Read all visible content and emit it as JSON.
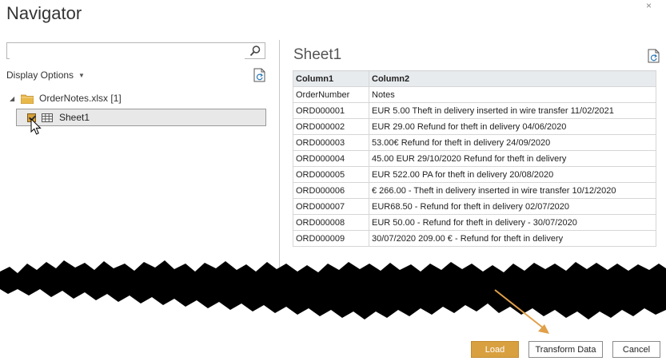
{
  "window": {
    "title": "Navigator",
    "close_glyph": "×"
  },
  "search": {
    "value": "",
    "placeholder": "",
    "icon": "search-icon"
  },
  "display_options": {
    "label": "Display Options",
    "caret": "▼"
  },
  "tree": {
    "file": {
      "label": "OrderNotes.xlsx [1]",
      "expander": "◢",
      "icon": "folder-icon"
    },
    "items": [
      {
        "label": "Sheet1",
        "checked": true,
        "icon": "table-icon"
      }
    ]
  },
  "preview": {
    "title": "Sheet1",
    "columns": [
      "Column1",
      "Column2"
    ],
    "rows": [
      [
        "OrderNumber",
        "Notes"
      ],
      [
        "ORD000001",
        "EUR 5.00 Theft in delivery inserted in wire transfer 11/02/2021"
      ],
      [
        "ORD000002",
        "EUR 29.00 Refund for theft in delivery 04/06/2020"
      ],
      [
        "ORD000003",
        "53.00€ Refund for theft in delivery 24/09/2020"
      ],
      [
        "ORD000004",
        "45.00 EUR 29/10/2020 Refund for theft in delivery"
      ],
      [
        "ORD000005",
        "EUR 522.00 PA for theft in delivery 20/08/2020"
      ],
      [
        "ORD000006",
        "€ 266.00 - Theft in delivery inserted in wire transfer 10/12/2020"
      ],
      [
        "ORD000007",
        "EUR68.50 - Refund for theft in delivery 02/07/2020"
      ],
      [
        "ORD000008",
        "EUR 50.00 - Refund for theft in delivery - 30/07/2020"
      ],
      [
        "ORD000009",
        "30/07/2020 209.00 € - Refund for theft in delivery"
      ]
    ]
  },
  "buttons": {
    "load": "Load",
    "transform": "Transform Data",
    "cancel": "Cancel"
  },
  "colors": {
    "accent": "#d9a040",
    "annotation_arrow": "#e0a04a",
    "torn_edge": "#000000"
  }
}
